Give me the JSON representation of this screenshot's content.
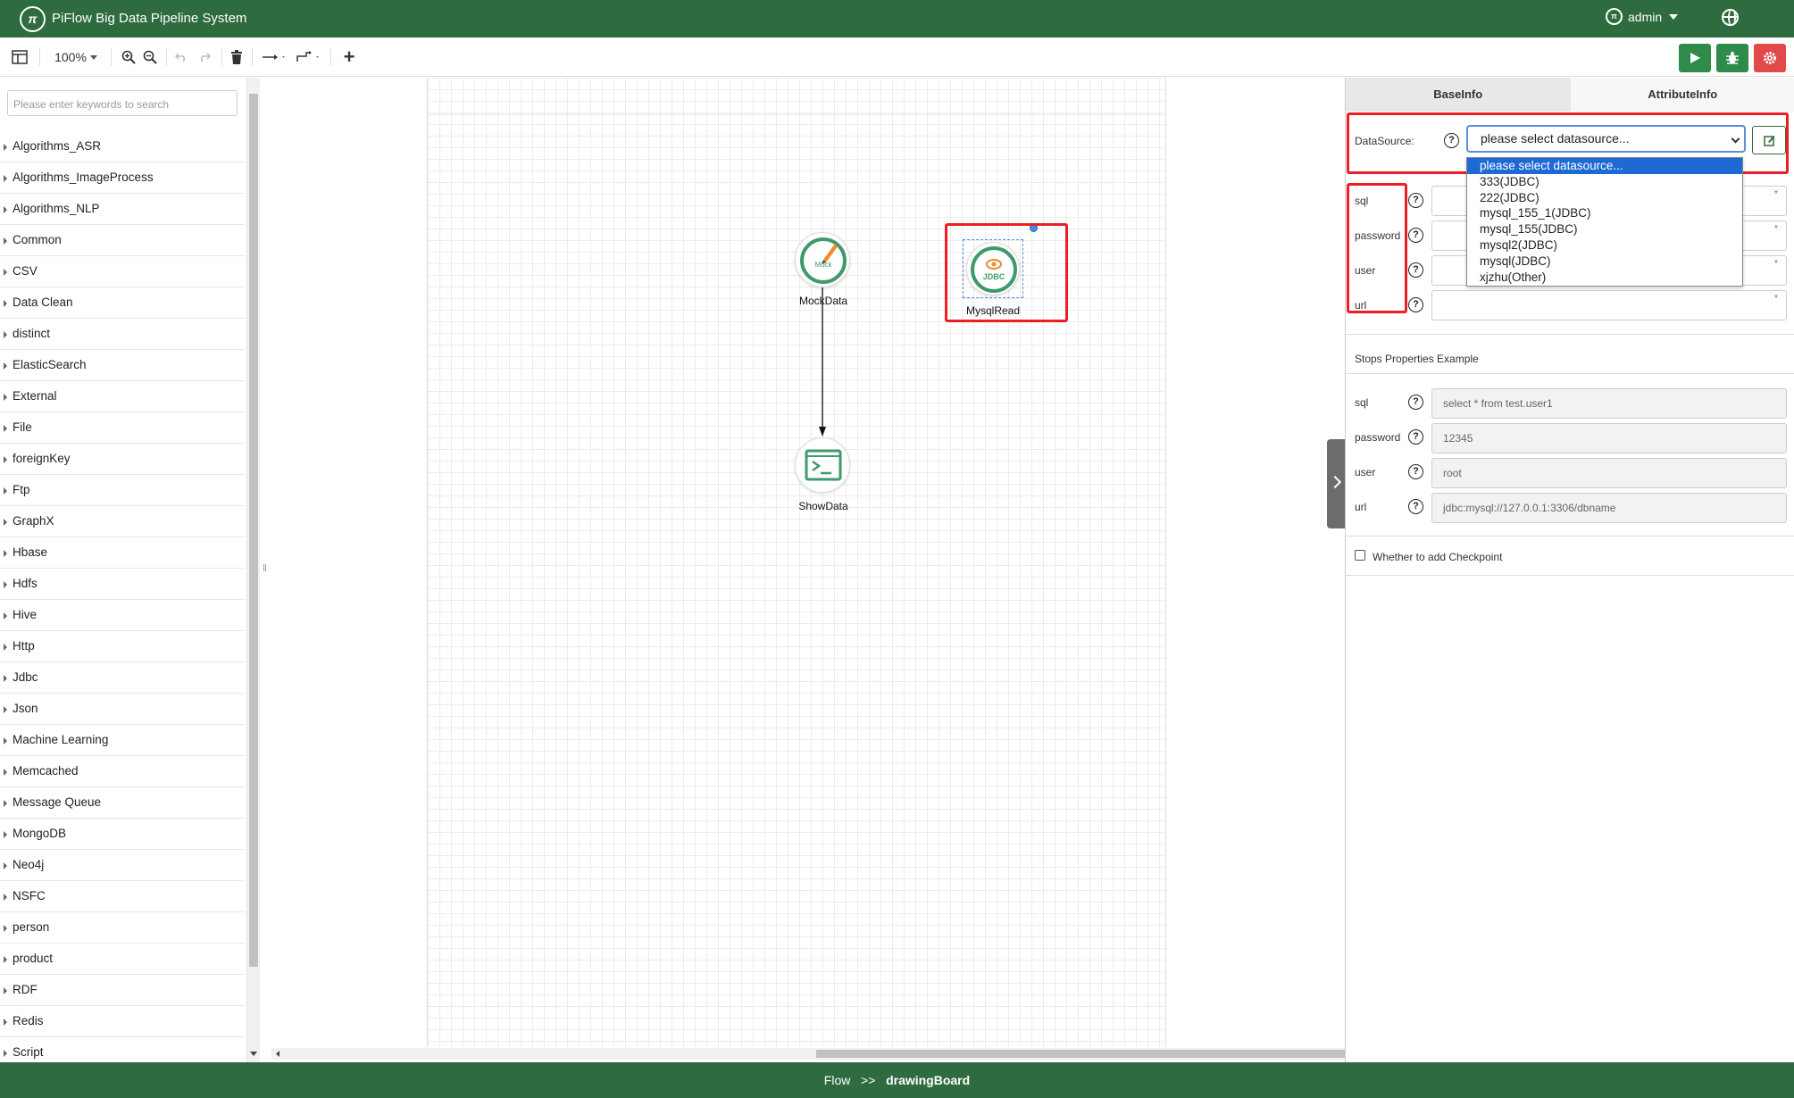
{
  "header": {
    "logo_text": "π",
    "title": "PiFlow Big Data Pipeline System",
    "user": "admin",
    "user_avatar": "π"
  },
  "toolbar": {
    "zoom": "100%",
    "icons": [
      "format-panel-icon",
      "zoom-in-icon",
      "zoom-out-icon",
      "undo-icon",
      "redo-icon",
      "delete-icon",
      "connection-icon",
      "waypoints-icon",
      "add-icon",
      "run-icon",
      "debug-icon",
      "stop-icon"
    ]
  },
  "search": {
    "placeholder": "Please enter keywords to search"
  },
  "categories": [
    "Algorithms_ASR",
    "Algorithms_ImageProcess",
    "Algorithms_NLP",
    "Common",
    "CSV",
    "Data Clean",
    "distinct",
    "ElasticSearch",
    "External",
    "File",
    "foreignKey",
    "Ftp",
    "GraphX",
    "Hbase",
    "Hdfs",
    "Hive",
    "Http",
    "Jdbc",
    "Json",
    "Machine Learning",
    "Memcached",
    "Message Queue",
    "MongoDB",
    "Neo4j",
    "NSFC",
    "person",
    "product",
    "RDF",
    "Redis",
    "Script"
  ],
  "canvas": {
    "nodes": [
      {
        "label": "MockData",
        "icon_text": "Mock"
      },
      {
        "label": "MysqlRead",
        "icon_text": "JDBC"
      },
      {
        "label": "ShowData"
      }
    ]
  },
  "panel": {
    "tabs": [
      "BaseInfo",
      "AttributeInfo"
    ],
    "datasource_label": "DataSource:",
    "datasource_value": "please select datasource...",
    "datasource_options": [
      "please select datasource...",
      "333(JDBC)",
      "222(JDBC)",
      "mysql_155_1(JDBC)",
      "mysql_155(JDBC)",
      "mysql2(JDBC)",
      "mysql(JDBC)",
      "xjzhu(Other)"
    ],
    "fields": [
      {
        "label": "sql",
        "value": ""
      },
      {
        "label": "password",
        "value": ""
      },
      {
        "label": "user",
        "value": ""
      },
      {
        "label": "url",
        "value": ""
      }
    ],
    "required_mark": "*",
    "example_title": "Stops Properties Example",
    "examples": [
      {
        "label": "sql",
        "value": "select * from test.user1"
      },
      {
        "label": "password",
        "value": "12345"
      },
      {
        "label": "user",
        "value": "root"
      },
      {
        "label": "url",
        "value": "jdbc:mysql://127.0.0.1:3306/dbname"
      }
    ],
    "checkpoint_label": "Whether to add Checkpoint",
    "help_glyph": "?"
  },
  "footer": {
    "flow": "Flow",
    "sep": ">>",
    "current": "drawingBoard"
  },
  "colors": {
    "brand_green": "#2e6b3e",
    "stop_red": "#e24a4a",
    "highlight_red": "#ee1c25",
    "node_green": "#3f9a6b",
    "jdbc_orange": "#f08a2a"
  }
}
